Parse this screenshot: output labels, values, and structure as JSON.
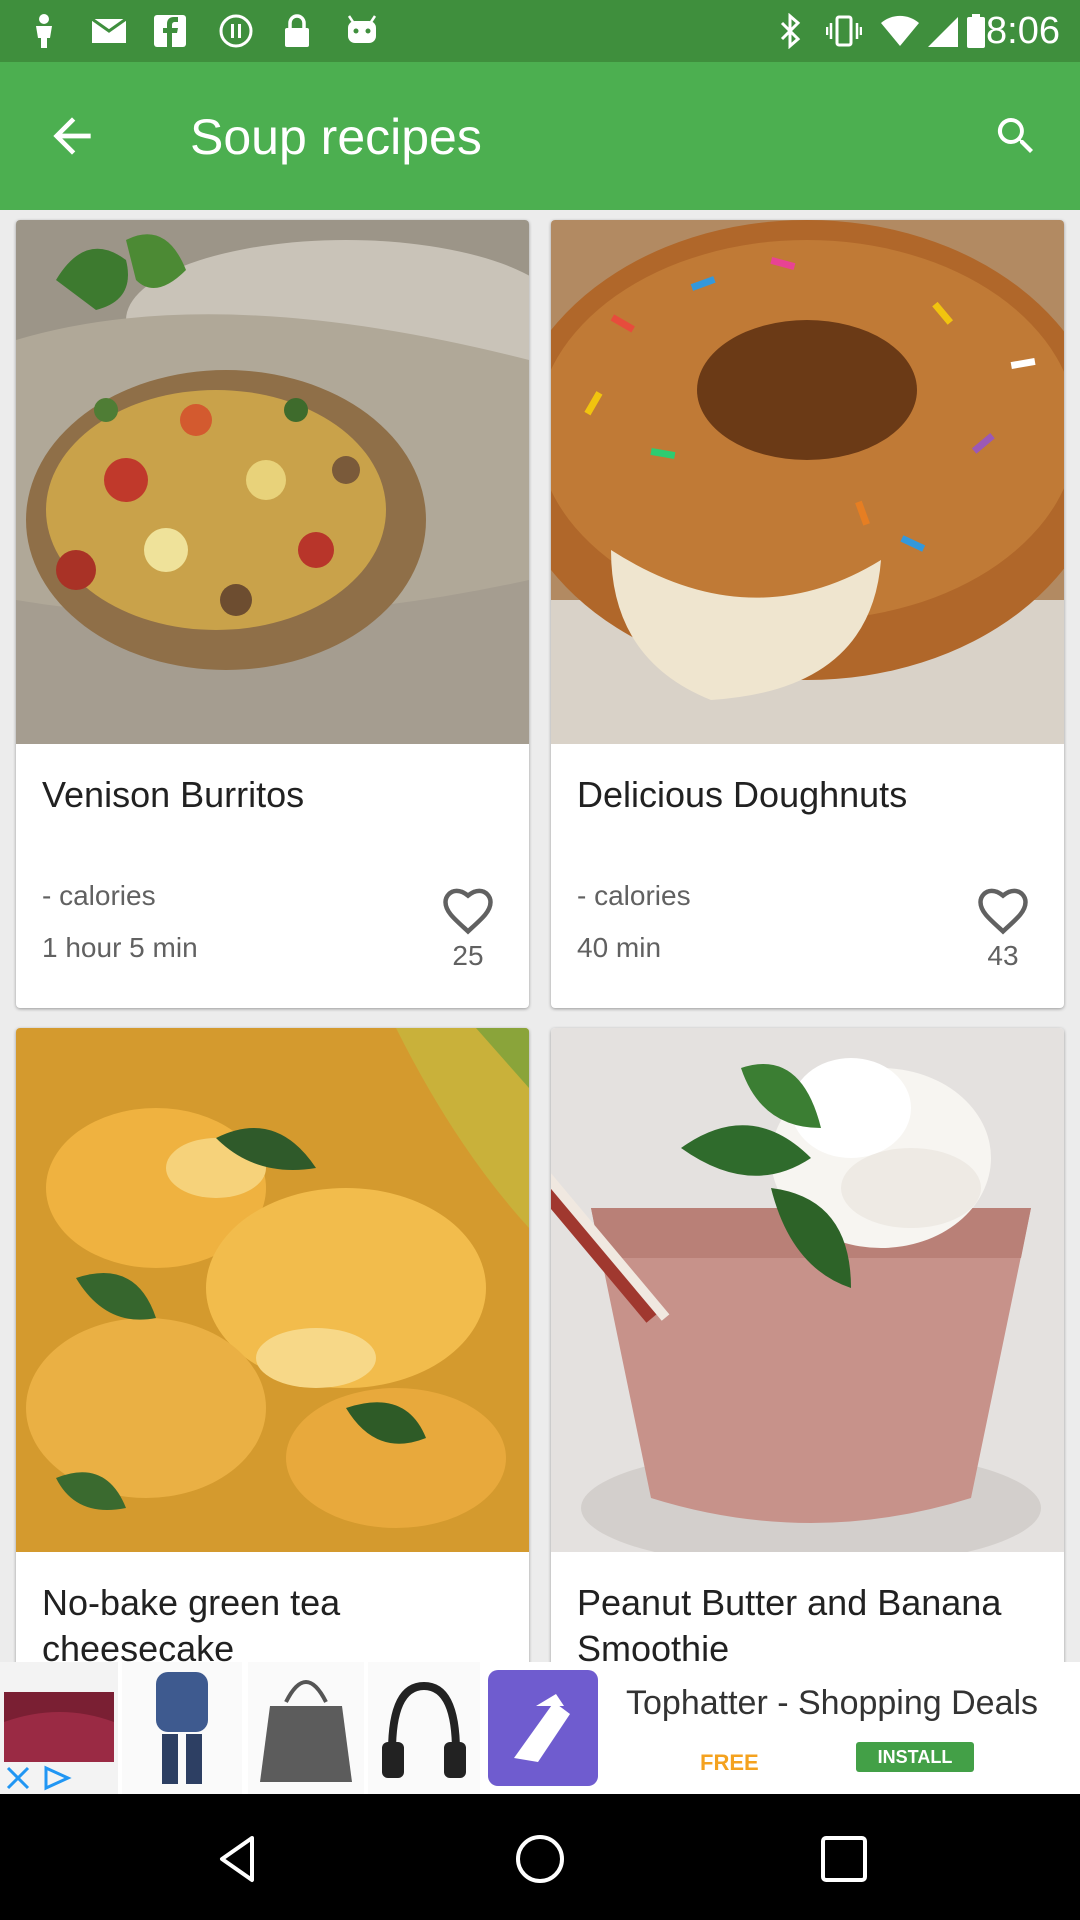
{
  "status_bar": {
    "time": "8:06",
    "icons": [
      "person-icon",
      "mail-icon",
      "facebook-icon",
      "media-icon",
      "lock-icon",
      "android-icon",
      "bluetooth-icon",
      "vibrate-icon",
      "wifi-icon",
      "signal-icon",
      "battery-icon"
    ]
  },
  "app_bar": {
    "title": "Soup recipes",
    "back_icon": "arrow-back-icon",
    "search_icon": "search-icon",
    "color": "#4caf50"
  },
  "recipes": [
    {
      "title": "Venison Burritos",
      "calories": "- calories",
      "time": "1 hour 5 min",
      "likes": "25"
    },
    {
      "title": "Delicious Doughnuts",
      "calories": "- calories",
      "time": "40 min",
      "likes": "43"
    },
    {
      "title": "No-bake green tea cheesecake"
    },
    {
      "title": "Peanut Butter and Banana Smoothie"
    }
  ],
  "ad": {
    "text": "Tophatter - Shopping Deals",
    "free_label": "FREE",
    "install_label": "INSTALL"
  },
  "nav_bar": {
    "icons": [
      "back-triangle-icon",
      "home-circle-icon",
      "recents-square-icon"
    ]
  }
}
